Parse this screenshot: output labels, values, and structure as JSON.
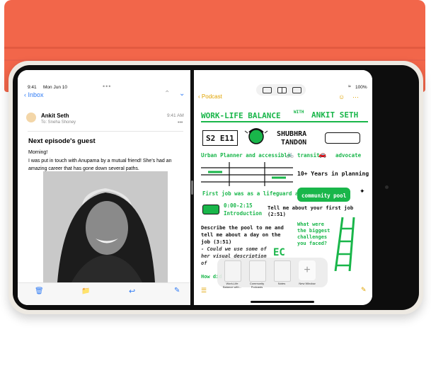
{
  "status_bar": {
    "time": "9:41",
    "date": "Mon Jun 10",
    "battery": "100%"
  },
  "mail": {
    "back_label": "Inbox",
    "sender": "Ankit Seth",
    "to_line": "To: Sneha Shoney",
    "time": "9:41 AM",
    "subject": "Next episode's guest",
    "greeting": "Morning!",
    "body": "I was put in touch with Anupama by a mutual friend! She's had an amazing career that has gone down several paths."
  },
  "notes": {
    "back_label": "Podcast",
    "title_left": "WORK-LIFE BALANCE",
    "title_with": "WITH",
    "title_right": "ANKIT SETH",
    "episode": "S2 E11",
    "guest_first": "SHUBHRA",
    "guest_last": "TANDON",
    "line_urban": "Urban Planner and accessible",
    "transit": "transit",
    "advocate": "advocate",
    "years": "10+ Years in planning",
    "first_job": "First job was as a lifeguard at a",
    "community_pool": "community pool",
    "timer": "0:00-2:15",
    "intro": "Introduction",
    "first_job_q": "Tell me about your first job (2:51)",
    "describe": "Describe the pool to me and tell me about a day on the job (3:51)",
    "could": "- Could we use some of her visual description of",
    "biggest": "What were the biggest challenges you faced?",
    "howdid": "How did",
    "shelf_labels": [
      "Work-Life Balance with...",
      "Community Podcasts",
      "Notes",
      "New Window"
    ]
  },
  "icons": [
    "wifi-icon",
    "battery-icon",
    "trash-icon",
    "folder-icon",
    "reply-icon",
    "compose-icon"
  ]
}
